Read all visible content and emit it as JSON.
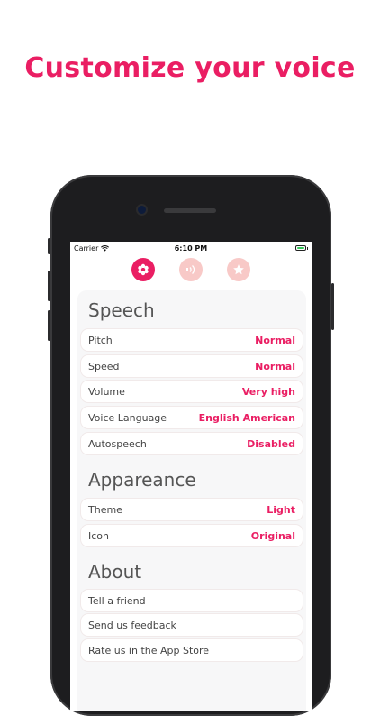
{
  "headline": "Customize your voice",
  "status_bar": {
    "carrier": "Carrier",
    "time": "6:10 PM"
  },
  "tabs": [
    {
      "name": "speech",
      "icon": "flower-icon",
      "active": true
    },
    {
      "name": "audio",
      "icon": "speaker-wave-icon",
      "active": false
    },
    {
      "name": "favorites",
      "icon": "star-icon",
      "active": false
    }
  ],
  "sections": {
    "speech": {
      "title": "Speech",
      "rows": [
        {
          "label": "Pitch",
          "value": "Normal"
        },
        {
          "label": "Speed",
          "value": "Normal"
        },
        {
          "label": "Volume",
          "value": "Very high"
        },
        {
          "label": "Voice Language",
          "value": "English American"
        },
        {
          "label": "Autospeech",
          "value": "Disabled"
        }
      ]
    },
    "appearance": {
      "title": "Appareance",
      "rows": [
        {
          "label": "Theme",
          "value": "Light"
        },
        {
          "label": "Icon",
          "value": "Original"
        }
      ]
    },
    "about": {
      "title": "About",
      "rows": [
        {
          "label": "Tell a friend"
        },
        {
          "label": "Send us feedback"
        },
        {
          "label": "Rate us in the App Store"
        }
      ]
    }
  },
  "colors": {
    "accent": "#ea1e63",
    "tab_inactive": "#f8c9c7",
    "panel": "#f7f7f8"
  }
}
